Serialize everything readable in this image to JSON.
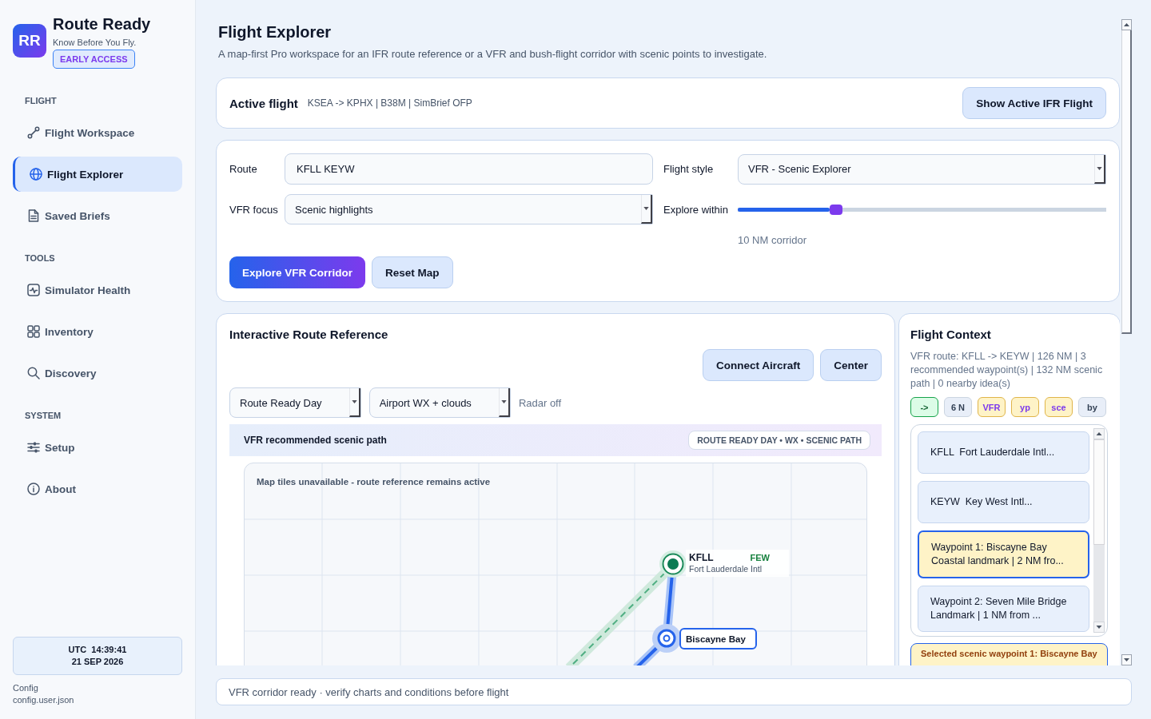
{
  "sidebar": {
    "brand": {
      "logo": "RR",
      "name": "Route Ready",
      "tagline": "Know Before You Fly.",
      "badge": "EARLY ACCESS"
    },
    "sections": [
      {
        "label": "FLIGHT",
        "items": [
          {
            "label": "Flight Workspace",
            "selected": false
          },
          {
            "label": "Flight Explorer",
            "selected": true
          },
          {
            "label": "Saved Briefs",
            "selected": false
          }
        ]
      },
      {
        "label": "TOOLS",
        "items": [
          {
            "label": "Simulator Health",
            "selected": false
          },
          {
            "label": "Inventory",
            "selected": false
          },
          {
            "label": "Discovery",
            "selected": false
          }
        ]
      },
      {
        "label": "SYSTEM",
        "items": [
          {
            "label": "Setup",
            "selected": false
          },
          {
            "label": "About",
            "selected": false
          }
        ]
      }
    ],
    "clock": {
      "time": "UTC  14:39:41",
      "date": "21 SEP 2026"
    },
    "config": {
      "label": "Config",
      "file": "config.user.json"
    }
  },
  "page": {
    "title": "Flight Explorer",
    "subtitle": "A map-first Pro workspace for an IFR route reference or a VFR and bush-flight corridor with scenic points to investigate."
  },
  "active_flight": {
    "label": "Active flight",
    "detail": "KSEA -> KPHX | B38M | SimBrief OFP",
    "button": "Show Active IFR Flight"
  },
  "form": {
    "fields": [
      {
        "kind": "input",
        "label": "Route",
        "value": "KFLL KEYW"
      },
      {
        "kind": "select",
        "label": "Flight style",
        "value": "VFR - Scenic Explorer"
      },
      {
        "kind": "select",
        "label": "VFR focus",
        "value": "Scenic highlights"
      },
      {
        "kind": "slider",
        "label": "Explore within",
        "level": 0.25,
        "reading": "10 NM corridor"
      }
    ],
    "buttons": [
      {
        "label": "Explore VFR Corridor",
        "kind": "primary"
      },
      {
        "label": "Reset Map",
        "kind": "secondary"
      }
    ]
  },
  "route_map": {
    "title": "Interactive Route Reference",
    "buttons": [
      {
        "label": "Connect Aircraft"
      },
      {
        "label": "Center"
      }
    ],
    "selects": [
      {
        "value": "Route Ready Day"
      },
      {
        "value": "Airport WX + clouds"
      }
    ],
    "radar_status": "Radar off",
    "banner": {
      "title": "VFR recommended scenic path",
      "pill": "ROUTE READY DAY • WX • SCENIC PATH"
    },
    "notice": "Map tiles unavailable - route reference remains active",
    "airports": [
      {
        "code": "KFLL",
        "wx": "FEW",
        "name": "Fort Lauderdale Intl"
      }
    ],
    "waypoints": [
      {
        "name": "Biscayne Bay"
      }
    ]
  },
  "flight_context": {
    "title": "Flight Context",
    "summary": "VFR route: KFLL -> KEYW | 126 NM | 3 recommended waypoint(s) | 132 NM scenic path | 0 nearby idea(s)",
    "chips": [
      {
        "text": "->",
        "kind": "route"
      },
      {
        "text": "6 N",
        "kind": "distance"
      },
      {
        "text": "VFR",
        "kind": "scenic"
      },
      {
        "text": "yp",
        "kind": "scenic"
      },
      {
        "text": "sce",
        "kind": "scenic"
      },
      {
        "text": "by",
        "kind": "nearby"
      }
    ],
    "items": [
      {
        "lines": [
          "KFLL  Fort Lauderdale Intl..."
        ],
        "selected": false
      },
      {
        "lines": [
          "KEYW  Key West Intl..."
        ],
        "selected": false
      },
      {
        "lines": [
          "Waypoint 1: Biscayne Bay",
          "Coastal landmark | 2 NM fro..."
        ],
        "selected": true
      },
      {
        "lines": [
          "Waypoint 2: Seven Mile Bridge",
          "Landmark | 1 NM from ..."
        ],
        "selected": false
      }
    ],
    "selected_note": "Selected scenic waypoint 1: Biscayne Bay"
  },
  "status_bar": {
    "message": "VFR corridor ready · verify charts and conditions before flight"
  }
}
